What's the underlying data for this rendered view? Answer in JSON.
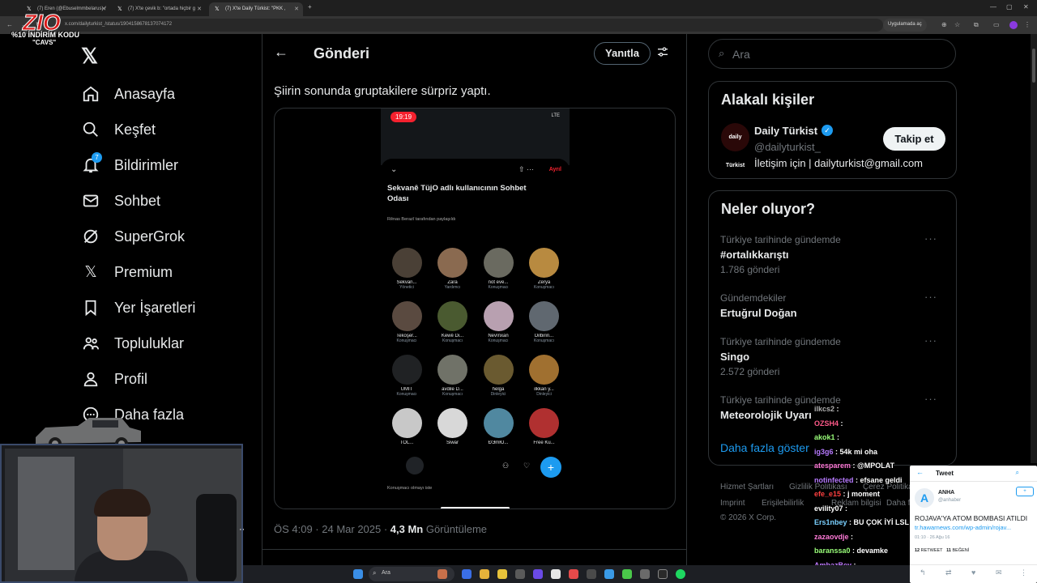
{
  "browser": {
    "tabs": [
      {
        "label": "(7) Eren (@Ebuselmmbelarus) /"
      },
      {
        "label": "(7) X'te çevik b: \"ortada hiçbir g"
      },
      {
        "label": "(7) X'te Daily Türkist: \"PKK ,"
      }
    ],
    "url": "x.com/dailyturkist_/status/1904158678137074172",
    "app_button": "Uygulamada aç"
  },
  "overlay": {
    "logo_text": "ZIO",
    "promo_line1": "%10 İNDİRİM KODU",
    "promo_line2": "\"CAVS\""
  },
  "nav": {
    "items": [
      {
        "label": "Anasayfa",
        "icon": "home-icon"
      },
      {
        "label": "Keşfet",
        "icon": "search-icon"
      },
      {
        "label": "Bildirimler",
        "icon": "bell-icon"
      },
      {
        "label": "Sohbet",
        "icon": "mail-icon"
      },
      {
        "label": "SuperGrok",
        "icon": "grok-icon"
      },
      {
        "label": "Premium",
        "icon": "x-icon"
      },
      {
        "label": "Yer İşaretleri",
        "icon": "bookmark-icon"
      },
      {
        "label": "Topluluklar",
        "icon": "communities-icon"
      },
      {
        "label": "Profil",
        "icon": "user-icon"
      },
      {
        "label": "Daha fazla",
        "icon": "more-icon"
      }
    ],
    "notif_count": "7"
  },
  "post": {
    "page_title": "Gönderi",
    "reply_button": "Yanıtla",
    "text": "Şiirin sonunda gruptakilere sürpriz yaptı.",
    "time": "ÖS 4:09 · 24 Mar 2025 · ",
    "views": "4,3 Mn",
    "views_label": " Görüntüleme"
  },
  "phone": {
    "time": "19:19",
    "status": "LTE",
    "leave": "Ayrıl",
    "room_title": "Sekvanê TüjO adlı kullanıcının Sohbet Odası",
    "shared_by": "Rênas Berazî tarafından paylaşıldı",
    "members": [
      {
        "name": "Sekvan...",
        "role": "Yönetici",
        "color": "#4a4036"
      },
      {
        "name": "Zara",
        "role": "Yardımcı",
        "color": "#8a6a50"
      },
      {
        "name": "not eve...",
        "role": "Konuşmacı",
        "color": "#6a6a60"
      },
      {
        "name": "Zerya",
        "role": "Konuşmacı",
        "color": "#b88a40"
      },
      {
        "name": "Tekoşer...",
        "role": "Konuşmacı",
        "color": "#5a4a40"
      },
      {
        "name": "Kewê Di...",
        "role": "Konuşmacı",
        "color": "#4a5a30"
      },
      {
        "name": "Nevînxan",
        "role": "Konuşmacı",
        "color": "#b8a0b0"
      },
      {
        "name": "Dilbirin...",
        "role": "Konuşmacı",
        "color": "#606870"
      },
      {
        "name": "ÜMİT",
        "role": "Konuşmacı",
        "color": "#202224"
      },
      {
        "name": "avdile D...",
        "role": "Konuşmacı",
        "color": "#707268"
      },
      {
        "name": "helga",
        "role": "Dinleyici",
        "color": "#6a5a30"
      },
      {
        "name": "ilkkan y...",
        "role": "Dinleyici",
        "color": "#a07030"
      },
      {
        "name": "TOL...",
        "role": "",
        "color": "#c8c8c8"
      },
      {
        "name": "Siwar",
        "role": "",
        "color": "#d8d8d8"
      },
      {
        "name": "ĐЭmЮ...",
        "role": "",
        "color": "#5088a0"
      },
      {
        "name": "Free Ku...",
        "role": "",
        "color": "#b03030"
      }
    ],
    "mic_text": "Konuşmacı olmayı iste"
  },
  "right": {
    "search_placeholder": "Ara",
    "related_title": "Alakalı kişiler",
    "account_name": "Daily Türkist",
    "account_handle": "@dailyturkist_",
    "account_bio": "İletişim için | dailyturkist@gmail.com",
    "avatar_text": "daily Türkist",
    "follow_button": "Takip et",
    "trends_title": "Neler oluyor?",
    "trends": [
      {
        "context": "Türkiye tarihinde gündemde",
        "title": "#ortalıkkarıştı",
        "count": "1.786 gönderi"
      },
      {
        "context": "Gündemdekiler",
        "title": "Ertuğrul Doğan",
        "count": ""
      },
      {
        "context": "Türkiye tarihinde gündemde",
        "title": "Singo",
        "count": "2.572 gönderi"
      },
      {
        "context": "Türkiye tarihinde gündemde",
        "title": "Meteorolojik Uyarı",
        "count": ""
      }
    ],
    "show_more": "Daha fazla göster",
    "footer": [
      "Hizmet Şartları",
      "Gizlilik Politikası",
      "Çerez Politikası",
      "Imprint",
      "Erişilebilirlik",
      "Reklam bilgisi",
      "Daha fazla",
      "© 2026 X Corp."
    ]
  },
  "chat": [
    {
      "user": "ilkcs2",
      "msg": "",
      "color": "#b0b0b0"
    },
    {
      "user": "OZSH4",
      "msg": "",
      "color": "#ff5a8a"
    },
    {
      "user": "akok1",
      "msg": "",
      "color": "#9aff7a"
    },
    {
      "user": "ig3g6",
      "msg": "54k mi oha",
      "color": "#b77aff"
    },
    {
      "user": "atesparem",
      "msg": "@MPOLAT",
      "color": "#ff7ad8"
    },
    {
      "user": "notinfected",
      "msg": "efsane geldi",
      "color": "#b77aff"
    },
    {
      "user": "efe_e15",
      "msg": "j moment",
      "color": "#ff4040"
    },
    {
      "user": "evility07",
      "msg": "",
      "color": "#ffffff"
    },
    {
      "user": "Ers1nbey",
      "msg": "BU ÇOK İYİ LSL",
      "color": "#7ad0ff"
    },
    {
      "user": "zazaovdje",
      "msg": "",
      "color": "#ff7ad8"
    },
    {
      "user": "baranssa0",
      "msg": "devamke",
      "color": "#9aff7a"
    },
    {
      "user": "AmbazBey",
      "msg": "",
      "color": "#c07aff"
    }
  ],
  "popup": {
    "title": "Tweet",
    "name": "ANHA",
    "handle": "@anhaber",
    "text": "ROJAVA'YA ATOM BOMBASI ATILDI",
    "link": "tr.hawarnews.com/wp-admin/rojav...",
    "date": "01:10 · 26 Ağu 16",
    "retweets": "12",
    "retweets_label": "RETWEET",
    "likes": "11",
    "likes_label": "BEĞENİ"
  },
  "taskbar": {
    "search_placeholder": "Ara"
  }
}
